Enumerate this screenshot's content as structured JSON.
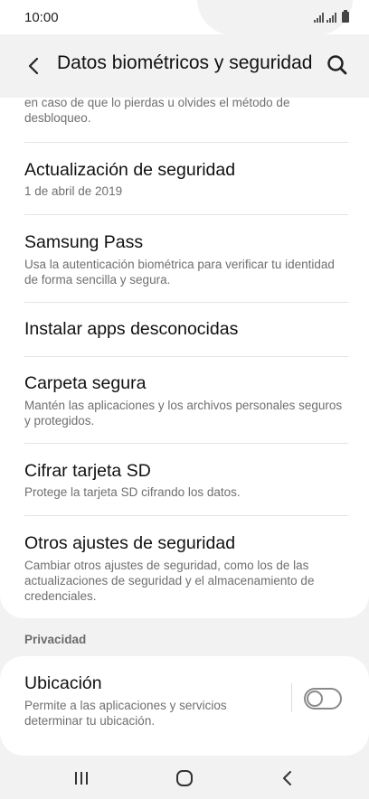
{
  "status": {
    "time": "10:00"
  },
  "header": {
    "title": "Datos biométricos y seguridad"
  },
  "clipped_item": {
    "subtitle_line1": "en caso de que lo pierdas u olvides el método de",
    "subtitle_line2": "desbloqueo."
  },
  "items": [
    {
      "title": "Actualización de seguridad",
      "subtitle": "1 de abril de 2019"
    },
    {
      "title": "Samsung Pass",
      "subtitle": "Usa la autenticación biométrica para verificar tu identidad de forma sencilla y segura."
    },
    {
      "title": "Instalar apps desconocidas",
      "subtitle": ""
    },
    {
      "title": "Carpeta segura",
      "subtitle": "Mantén las aplicaciones y los archivos personales seguros y protegidos."
    },
    {
      "title": "Cifrar tarjeta SD",
      "subtitle": "Protege la tarjeta SD cifrando los datos."
    },
    {
      "title": "Otros ajustes de seguridad",
      "subtitle": "Cambiar otros ajustes de seguridad, como los de las actualizaciones de seguridad y el almacenamiento de credenciales."
    }
  ],
  "privacy": {
    "section_label": "Privacidad",
    "location": {
      "title": "Ubicación",
      "subtitle": "Permite a las aplicaciones y servicios determinar tu ubicación.",
      "toggle_on": false
    }
  },
  "icons": {
    "back": "back-arrow-icon",
    "search": "search-icon",
    "recents": "recent-apps-icon",
    "home": "home-icon",
    "nav_back": "nav-back-icon"
  }
}
